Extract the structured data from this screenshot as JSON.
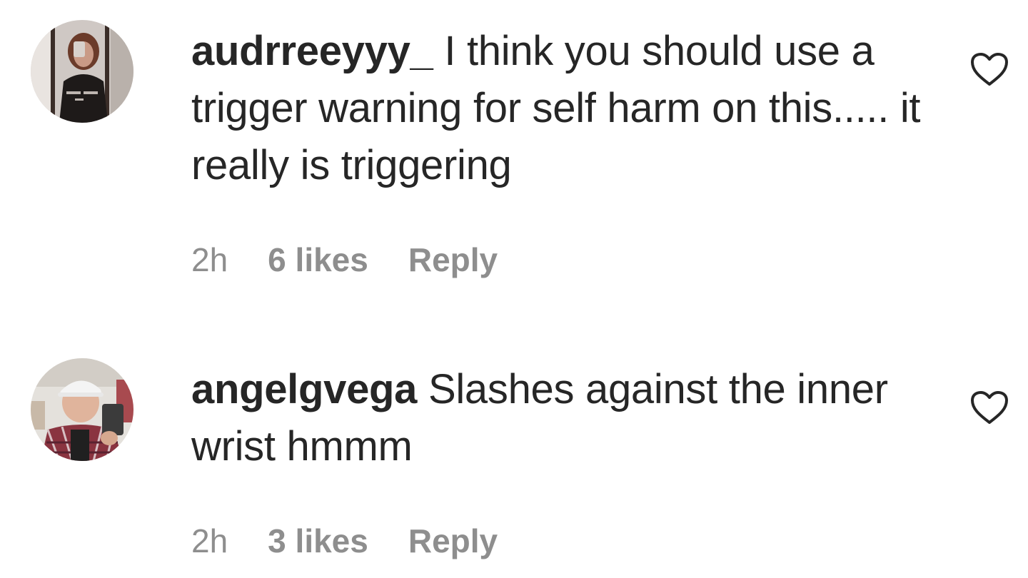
{
  "comments": [
    {
      "username": "audrreeyyy_",
      "text": "I think you should use a trigger warning for self harm on this..... it really is triggering",
      "time": "2h",
      "likes": "6 likes",
      "reply_label": "Reply",
      "avatar_icon": "profile-photo-mirror-selfie",
      "like_icon": "heart-outline-icon"
    },
    {
      "username": "angelgvega",
      "text": "Slashes against the inner wrist hmmm",
      "time": "2h",
      "likes": "3 likes",
      "reply_label": "Reply",
      "avatar_icon": "profile-photo-white-cap-selfie",
      "like_icon": "heart-outline-icon"
    }
  ],
  "colors": {
    "text": "#262626",
    "meta": "#8e8e8e",
    "background": "#ffffff"
  }
}
